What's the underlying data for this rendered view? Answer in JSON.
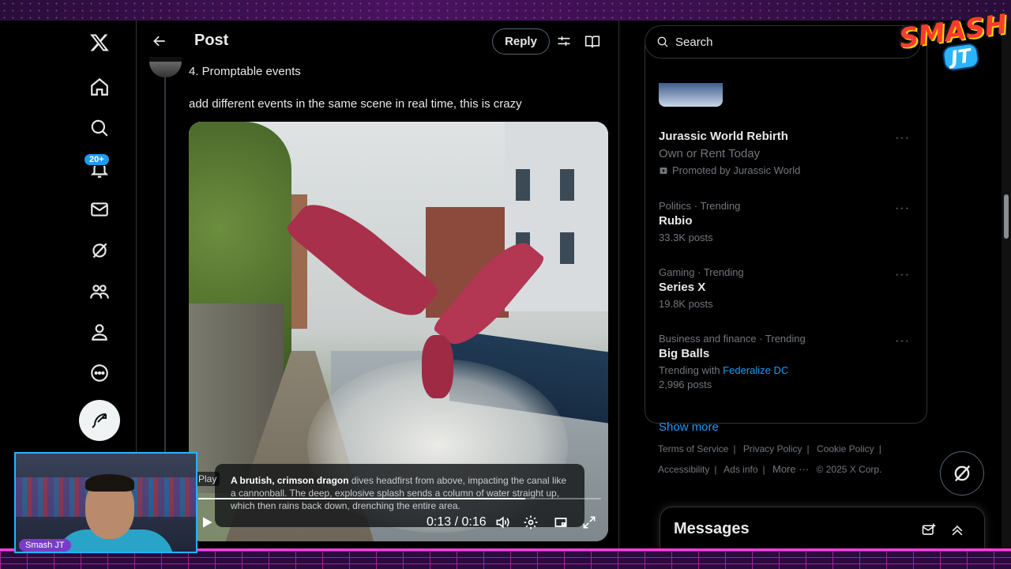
{
  "header": {
    "title": "Post",
    "reply_label": "Reply"
  },
  "nav": {
    "notifications_badge": "20+"
  },
  "tweet": {
    "line1": "4. Promptable events",
    "line2": "add different events in the same scene in real time, this is crazy"
  },
  "video": {
    "caption_bold": "A brutish, crimson dragon",
    "caption_rest": " dives headfirst from above, impacting the canal like a cannonball. The deep, explosive splash sends a column of water straight up, which then rains back down, drenching the entire area.",
    "play_tooltip": "Play",
    "current_time": "0:13",
    "separator": "/",
    "duration": "0:16",
    "progress_fraction": 0.8125
  },
  "search": {
    "placeholder": "Search"
  },
  "trends": {
    "promo": {
      "title": "Jurassic World Rebirth",
      "subtitle": "Own or Rent Today",
      "by": "Promoted by Jurassic World"
    },
    "items": [
      {
        "meta": "Politics · Trending",
        "name": "Rubio",
        "count": "33.3K posts"
      },
      {
        "meta": "Gaming · Trending",
        "name": "Series X",
        "count": "19.8K posts"
      },
      {
        "meta": "Business and finance · Trending",
        "name": "Big Balls",
        "with_label": "Trending with ",
        "with_link": "Federalize DC",
        "count": "2,996 posts"
      }
    ],
    "show_more": "Show more"
  },
  "footer": {
    "links": [
      "Terms of Service",
      "|",
      "Privacy Policy",
      "|",
      "Cookie Policy",
      "|",
      "Accessibility",
      "|",
      "Ads info",
      "|",
      "More ···",
      "© 2025 X Corp."
    ]
  },
  "messages": {
    "title": "Messages"
  },
  "overlay": {
    "logo_line1": "SMASH",
    "logo_line2": "JT",
    "webcam_name": "Smash JT"
  },
  "colors": {
    "accent": "#1d9bf0",
    "background": "#000000",
    "border": "#2f3336",
    "muted_text": "#71767b"
  }
}
